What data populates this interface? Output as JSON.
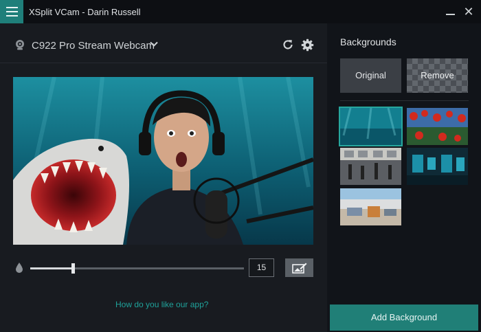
{
  "window": {
    "title": "XSplit VCam - Darin Russell",
    "minimize_glyph": "",
    "close_glyph": "✕"
  },
  "camera": {
    "name": "C922 Pro Stream Webcam"
  },
  "blur": {
    "value": "15",
    "slider_fraction": 0.2
  },
  "feedback_link": "How do you like our app?",
  "backgrounds": {
    "title": "Backgrounds",
    "original_label": "Original",
    "remove_label": "Remove",
    "thumbnails": [
      "underwater",
      "red-flowers",
      "city-street",
      "control-room",
      "office-lounge"
    ],
    "selected_index": 0
  },
  "add_background_label": "Add Background",
  "colors": {
    "accent": "#207f77",
    "link": "#1fa39b"
  },
  "icons": [
    "hamburger-menu-icon",
    "webcam-icon",
    "chevron-down-icon",
    "refresh-icon",
    "gear-icon",
    "droplet-icon",
    "edit-image-icon",
    "minimize-icon",
    "close-icon"
  ]
}
